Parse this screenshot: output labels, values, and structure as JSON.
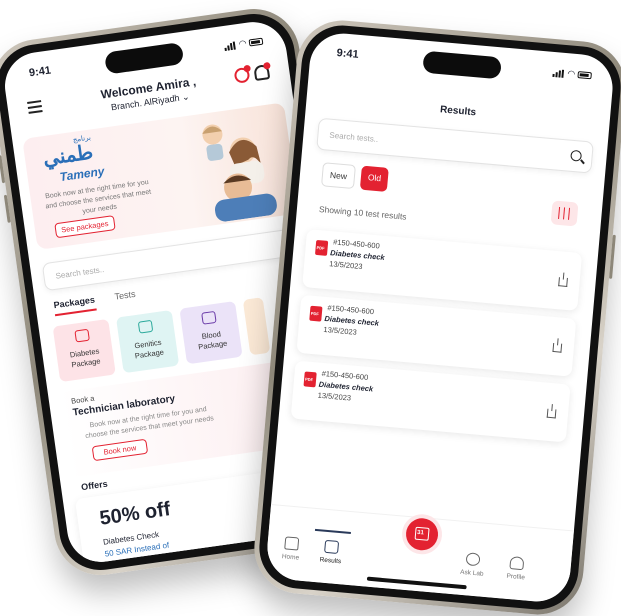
{
  "left_app": {
    "status_time": "9:41",
    "header": {
      "welcome": "Welcome Amira ,",
      "branch": "Branch. AlRiyadh"
    },
    "banner": {
      "brand_arabic": "طمني",
      "brand_arabic_small": "برنامج",
      "brand_english": "Tameny",
      "text": "Book now at the right time for you and choose the services that meet your needs",
      "button": "See packages"
    },
    "search": {
      "placeholder": "Search tests.."
    },
    "tabs": [
      {
        "label": "Packages"
      },
      {
        "label": "Tests"
      }
    ],
    "packages": [
      {
        "line1": "Diabetes",
        "line2": "Package",
        "bg": "#fde3e7",
        "icon_color": "#e32231",
        "icon": "blood-drop-icon"
      },
      {
        "line1": "Genitics",
        "line2": "Package",
        "bg": "#dff4f3",
        "icon_color": "#2ba99b",
        "icon": "dna-icon"
      },
      {
        "line1": "Blood",
        "line2": "Package",
        "bg": "#ebe3f8",
        "icon_color": "#6a3aa8",
        "icon": "blood-cells-icon"
      }
    ],
    "technician": {
      "small": "Book a",
      "title": "Technician laboratory",
      "text": "Book now at the right time for you and choose the services that meet your needs",
      "button": "Book now"
    },
    "offers": {
      "heading": "Offers",
      "discount": "50% off",
      "name": "Diabetes Check",
      "price": "50 SAR Instead of"
    }
  },
  "right_app": {
    "status_time": "9:41",
    "title": "Results",
    "search": {
      "placeholder": "Search tests.."
    },
    "segments": [
      {
        "label": "New"
      },
      {
        "label": "Old"
      }
    ],
    "showing": "Showing 10 test results",
    "results": [
      {
        "id": "#150-450-600",
        "name": "Diabetes check",
        "date": "13/5/2023"
      },
      {
        "id": "#150-450-600",
        "name": "Diabetes check",
        "date": "13/5/2023"
      },
      {
        "id": "#150-450-600",
        "name": "Diabetes check",
        "date": "13/5/2023"
      }
    ],
    "tabbar": {
      "home": "Home",
      "results": "Results",
      "calendar_day": "31",
      "ask_lab": "Ask Lab",
      "profile": "Profile"
    }
  },
  "colors": {
    "accent": "#e32231",
    "brand_blue": "#2a6fb8",
    "navy": "#2a3a5a"
  }
}
